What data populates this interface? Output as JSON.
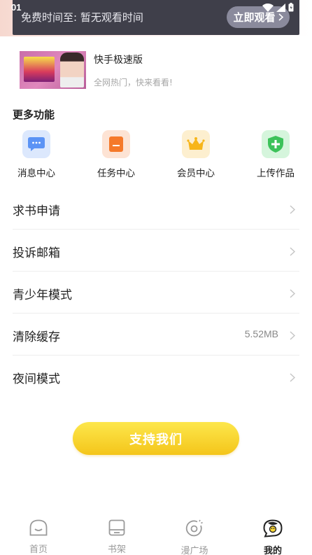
{
  "status_bar": {
    "time": "01"
  },
  "free_banner": {
    "text": "免费时间至: 暂无观看时间",
    "button_label": "立即观看"
  },
  "ad": {
    "title": "快手极速版",
    "subtitle": "全网热门，快来看看!"
  },
  "more_functions": {
    "title": "更多功能",
    "items": [
      {
        "label": "消息中心",
        "icon": "message-icon",
        "color": "#5b93f5",
        "bg": "#dce8fd"
      },
      {
        "label": "任务中心",
        "icon": "task-icon",
        "color": "#f5792a",
        "bg": "#fde3d4"
      },
      {
        "label": "会员中心",
        "icon": "crown-icon",
        "color": "#f7b519",
        "bg": "#fdefcf"
      },
      {
        "label": "上传作品",
        "icon": "upload-shield-icon",
        "color": "#3cc25a",
        "bg": "#d5f5dc"
      }
    ]
  },
  "menu": [
    {
      "label": "求书申请",
      "value": ""
    },
    {
      "label": "投诉邮箱",
      "value": ""
    },
    {
      "label": "青少年模式",
      "value": ""
    },
    {
      "label": "清除缓存",
      "value": "5.52MB"
    },
    {
      "label": "夜间模式",
      "value": ""
    }
  ],
  "support_button": "支持我们",
  "tabbar": {
    "items": [
      {
        "label": "首页",
        "icon": "home-icon"
      },
      {
        "label": "书架",
        "icon": "bookshelf-icon"
      },
      {
        "label": "漫广场",
        "icon": "comic-square-icon"
      },
      {
        "label": "我的",
        "icon": "mine-icon"
      }
    ],
    "active": "我的"
  }
}
